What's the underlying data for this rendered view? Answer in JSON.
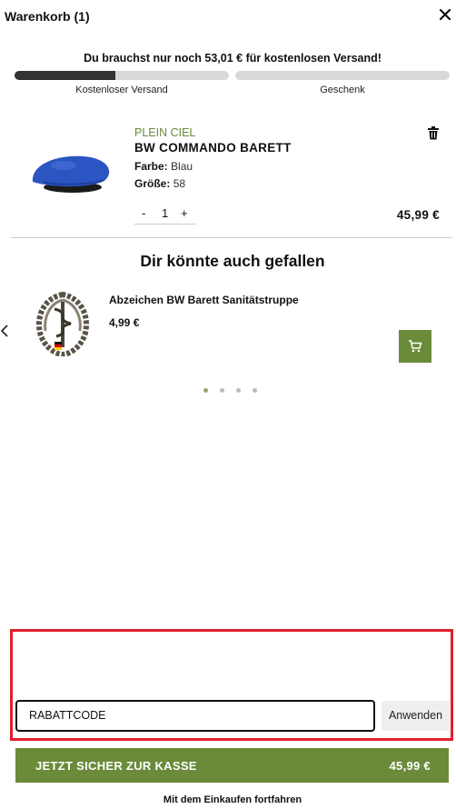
{
  "header": {
    "title": "Warenkorb (1)",
    "close_icon": "close-icon"
  },
  "shipping": {
    "message": "Du brauchst nur noch 53,01 € für kostenlosen Versand!",
    "progress_fraction": 0.47,
    "milestones": [
      "Kostenloser Versand",
      "Geschenk"
    ]
  },
  "cart_item": {
    "brand": "PLEIN CIEL",
    "name": "BW COMMANDO BARETT",
    "color_label": "Farbe:",
    "color_value": "Blau",
    "size_label": "Größe:",
    "size_value": "58",
    "qty_minus": "-",
    "quantity": "1",
    "qty_plus": "+",
    "price": "45,99 €",
    "image_color": "#2b55c2",
    "delete_icon": "trash-icon"
  },
  "recommendations": {
    "title": "Dir könnte auch gefallen",
    "items": [
      {
        "name": "Abzeichen BW Barett Sanitätstruppe",
        "price": "4,99 €"
      }
    ],
    "prev_icon": "chevron-left-icon",
    "add_icon": "cart-icon",
    "page_count": 4,
    "active_page": 1
  },
  "coupon": {
    "value": "RABATTCODE",
    "apply_label": "Anwenden"
  },
  "checkout": {
    "label": "JETZT SICHER ZUR KASSE",
    "total": "45,99 €"
  },
  "continue_label": "Mit dem Einkaufen fortfahren",
  "colors": {
    "accent": "#6b8a3a",
    "highlight": "#e0202a"
  }
}
